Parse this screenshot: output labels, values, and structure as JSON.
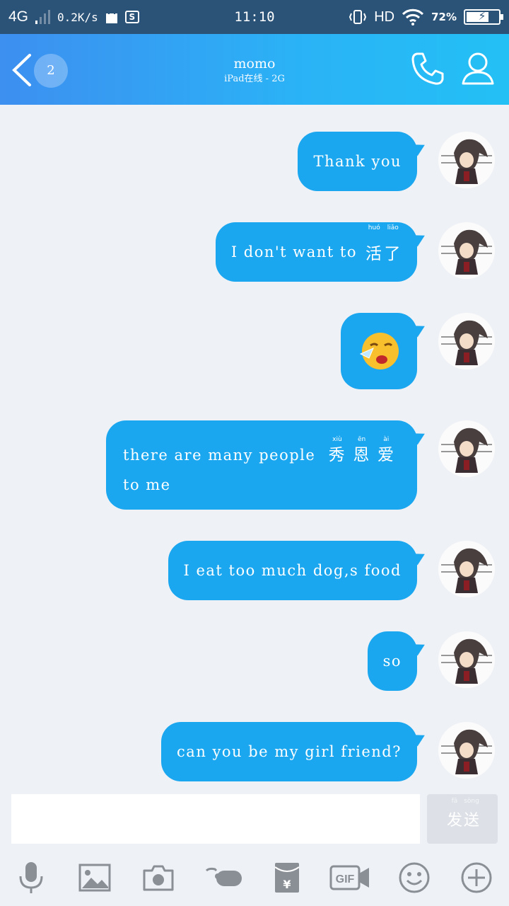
{
  "status_bar": {
    "network": "4G",
    "speed": "0.2K/s",
    "sim_icon": "S",
    "time": "11:10",
    "hd": "HD",
    "battery_percent": "72%",
    "battery_level": 0.72
  },
  "header": {
    "unread_count": "2",
    "contact_name": "momo",
    "contact_status": "iPad在线 - 2G"
  },
  "messages": [
    {
      "text": "Thank you"
    },
    {
      "text": "I don't want to",
      "ruby": [
        {
          "char": "活",
          "pinyin": "huó"
        },
        {
          "char": "了",
          "pinyin": "liǎo"
        }
      ]
    },
    {
      "emoji": "crying-face-emoji"
    },
    {
      "line1": "there are many people",
      "line2": "to me",
      "ruby": [
        {
          "char": "秀",
          "pinyin": "xiù"
        },
        {
          "char": "恩",
          "pinyin": "ēn"
        },
        {
          "char": "爱",
          "pinyin": "ài"
        }
      ]
    },
    {
      "text": "I eat too much dog,s food"
    },
    {
      "text": "so"
    },
    {
      "text": "can you be my girl friend?"
    }
  ],
  "input": {
    "value": "",
    "send_chars": [
      {
        "char": "发",
        "pinyin": "fā"
      },
      {
        "char": "送",
        "pinyin": "sòng"
      }
    ]
  },
  "toolbar": {
    "icons": [
      "microphone-icon",
      "image-icon",
      "camera-icon",
      "poke-icon",
      "red-packet-icon",
      "gif-icon",
      "emoji-icon",
      "plus-icon"
    ],
    "gif_label": "GIF",
    "red_packet_symbol": "¥"
  },
  "colors": {
    "bubble": "#1ba7ef",
    "header_start": "#3d8ff0",
    "header_end": "#23c0f5",
    "status_bar": "#2b5277",
    "background": "#eef1f6",
    "toolbar_icon": "#8a8f96"
  }
}
